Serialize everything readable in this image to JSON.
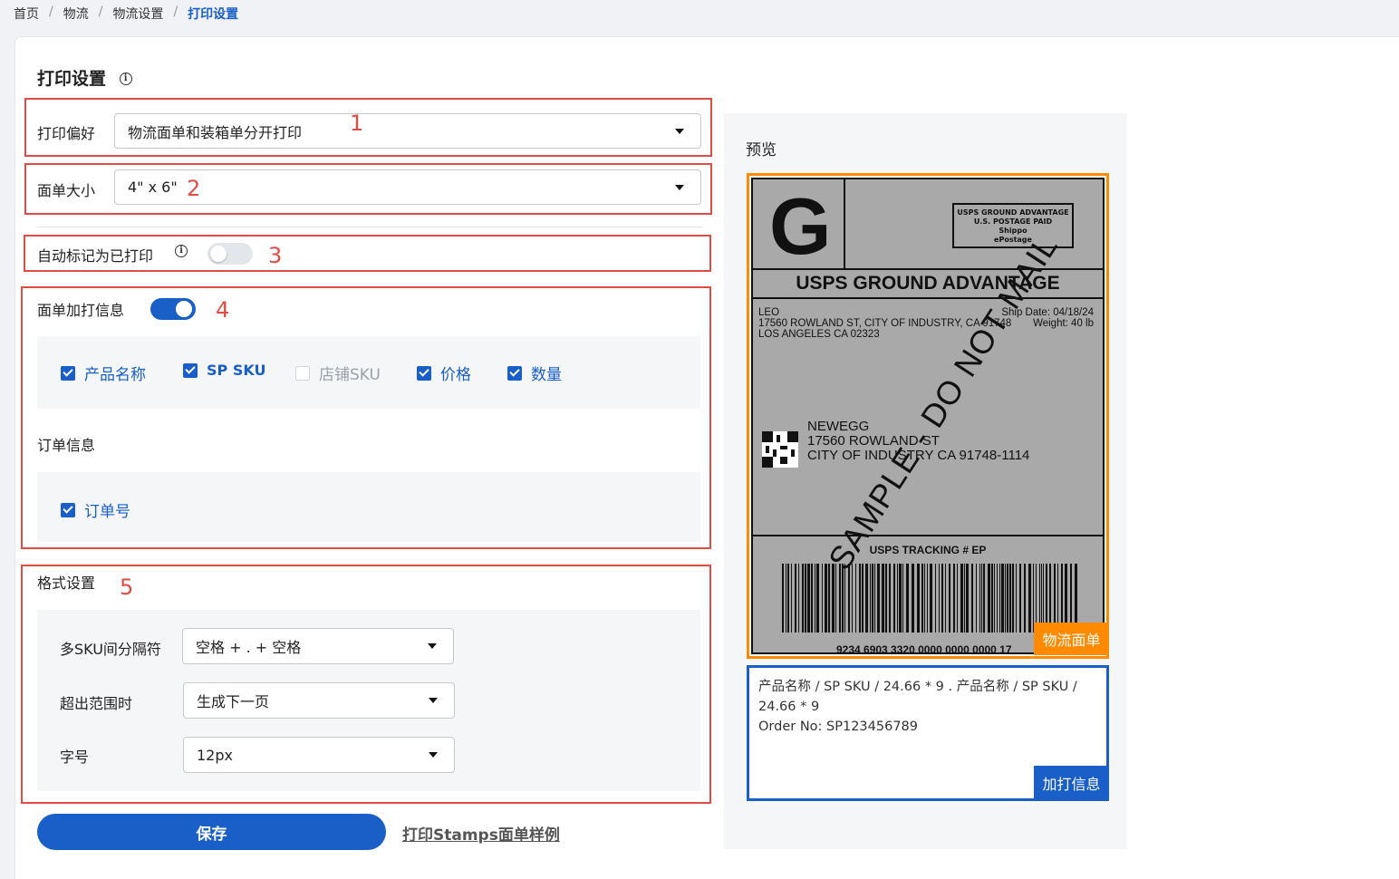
{
  "breadcrumb": [
    "首页",
    "物流",
    "物流设置",
    "打印设置"
  ],
  "page_title": "打印设置",
  "print_preference": {
    "label": "打印偏好",
    "value": "物流面单和装箱单分开打印"
  },
  "label_size": {
    "label": "面单大小",
    "value": "4\" x 6\""
  },
  "auto_mark": {
    "label": "自动标记为已打印",
    "enabled": false
  },
  "extra_info": {
    "label": "面单加打信息",
    "enabled": true,
    "product_options": [
      {
        "label": "产品名称",
        "checked": true
      },
      {
        "label": "SP SKU",
        "checked": true
      },
      {
        "label": "店铺SKU",
        "checked": false
      },
      {
        "label": "价格",
        "checked": true
      },
      {
        "label": "数量",
        "checked": true
      }
    ],
    "order_section_label": "订单信息",
    "order_options": [
      {
        "label": "订单号",
        "checked": true
      }
    ]
  },
  "format": {
    "label": "格式设置",
    "separator": {
      "label": "多SKU间分隔符",
      "value": "空格 + . + 空格"
    },
    "overflow": {
      "label": "超出范围时",
      "value": "生成下一页"
    },
    "font_size": {
      "label": "字号",
      "value": "12px"
    }
  },
  "annotations": [
    "1",
    "2",
    "3",
    "4",
    "5"
  ],
  "save_label": "保存",
  "print_sample_link": "打印Stamps面单样例",
  "preview": {
    "title": "预览",
    "label": {
      "big_letter": "G",
      "stamp_lines": [
        "USPS GROUND ADVANTAGE",
        "U.S. POSTAGE PAID",
        "Shippo",
        "ePostage"
      ],
      "service": "USPS GROUND ADVANTAGE",
      "from_lines": [
        "LEO",
        "17560 ROWLAND ST, CITY OF INDUSTRY, CA 91748",
        "LOS ANGELES CA 02323"
      ],
      "ship_date": "Ship Date: 04/18/24",
      "weight": "Weight: 40 lb",
      "to_lines": [
        "NEWEGG",
        "17560 ROWLAND ST",
        "CITY OF INDUSTRY CA 91748-1114"
      ],
      "tracking_title": "USPS TRACKING # EP",
      "tracking_number": "9234 6903 3320 0000 0000 0000 17",
      "watermark": "SAMPLE - DO NOT MAIL"
    },
    "label_tag": "物流面单",
    "extra_text": "产品名称 / SP SKU / 24.66 * 9 . 产品名称 / SP SKU / 24.66 * 9",
    "order_line": "Order No: SP123456789",
    "extra_tag": "加打信息"
  },
  "colors": {
    "accent": "#1a5fc8",
    "annotation_red": "#e04b44",
    "orange": "#ff8a00"
  }
}
